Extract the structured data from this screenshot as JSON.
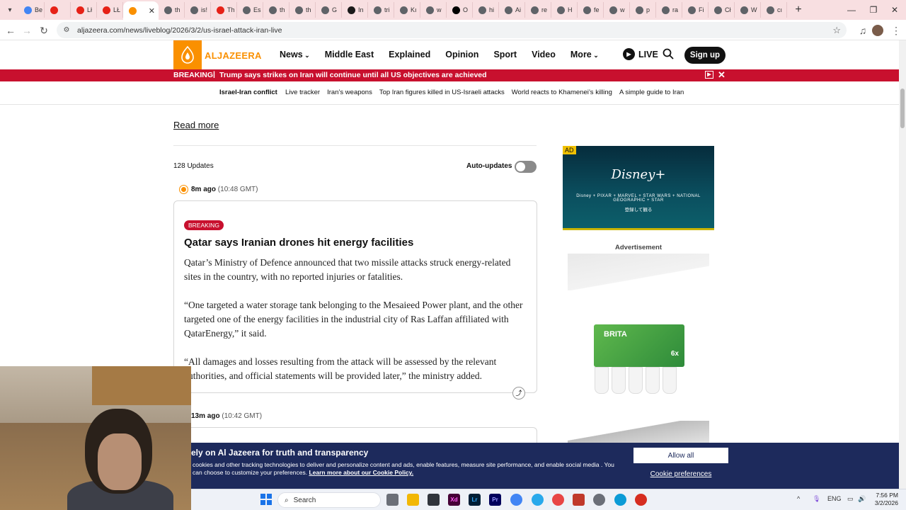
{
  "browser": {
    "tabs": [
      {
        "label": "Be",
        "color": "#4285f4"
      },
      {
        "label": "",
        "color": "#e62117"
      },
      {
        "label": "Lł",
        "color": "#e62117"
      },
      {
        "label": "LŁ",
        "color": "#e62117"
      },
      {
        "label": "",
        "color": "#fa9000",
        "active": true
      },
      {
        "label": "th",
        "color": "#5f6368"
      },
      {
        "label": "is!",
        "color": "#5f6368"
      },
      {
        "label": "Th",
        "color": "#e62117"
      },
      {
        "label": "Es",
        "color": "#5f6368"
      },
      {
        "label": "th",
        "color": "#5f6368"
      },
      {
        "label": "th",
        "color": "#5f6368"
      },
      {
        "label": "G",
        "color": "#5f6368"
      },
      {
        "label": "In",
        "color": "#1a1a1a"
      },
      {
        "label": "tri",
        "color": "#5f6368"
      },
      {
        "label": "Kı",
        "color": "#5f6368"
      },
      {
        "label": "w",
        "color": "#5f6368"
      },
      {
        "label": "O",
        "color": "#000000"
      },
      {
        "label": "hi",
        "color": "#5f6368"
      },
      {
        "label": "Ai",
        "color": "#5f6368"
      },
      {
        "label": "re",
        "color": "#5f6368"
      },
      {
        "label": "H",
        "color": "#5f6368"
      },
      {
        "label": "fe",
        "color": "#5f6368"
      },
      {
        "label": "w",
        "color": "#5f6368"
      },
      {
        "label": "p",
        "color": "#5f6368"
      },
      {
        "label": "ra",
        "color": "#5f6368"
      },
      {
        "label": "Fi",
        "color": "#5f6368"
      },
      {
        "label": "Cł",
        "color": "#5f6368"
      },
      {
        "label": "W",
        "color": "#5f6368"
      },
      {
        "label": "cı",
        "color": "#5f6368"
      }
    ],
    "url": "aljazeera.com/news/liveblog/2026/3/2/us-israel-attack-iran-live"
  },
  "site": {
    "logo": "ALJAZEERA",
    "nav": [
      "News",
      "Middle East",
      "Explained",
      "Opinion",
      "Sport",
      "Video",
      "More"
    ],
    "live": "LIVE",
    "signup": "Sign up",
    "breaking_label": "BREAKING",
    "breaking_separator": "|",
    "breaking_text": "Trump says strikes on Iran will continue until all US objectives are achieved",
    "subnav_title": "Israel-Iran conflict",
    "subnav_links": [
      "Live tracker",
      "Iran’s weapons",
      "Top Iran figures killed in US-Israeli attacks",
      "World reacts to Khamenei’s killing",
      "A simple guide to Iran"
    ]
  },
  "liveblog": {
    "read_more": "Read more",
    "updates_count": "128 Updates",
    "auto_updates_label": "Auto-updates",
    "post1": {
      "ago": "8m ago",
      "time": "(10:48 GMT)",
      "badge": "BREAKING",
      "title": "Qatar says Iranian drones hit energy facilities",
      "p1": "Qatar’s Ministry of Defence announced that two missile attacks struck energy-related sites in the country, with no reported injuries or fatalities.",
      "p2": "“One targeted a water storage tank belonging to the Mesaieed Power plant, and the other targeted one of the energy facilities in the industrial city of Ras Laffan affiliated with QatarEnergy,” it said.",
      "p3": "“All damages and losses resulting from the attack will be assessed by the relevant authorities, and official statements will be provided later,” the ministry added."
    },
    "post2": {
      "ago": "13m ago",
      "time": "(10:42 GMT)"
    }
  },
  "ads": {
    "ad_label": "AD",
    "disney": "Disney+",
    "brands": "Disney + PIXAR + MARVEL + STAR WARS + NATIONAL GEOGRAPHIC + STAR",
    "jp_text": "登録して観る",
    "advertisement_label": "Advertisement",
    "brita": "BRITA",
    "six": "6x"
  },
  "cookie": {
    "heading": "ely on Al Jazeera for truth and transparency",
    "body": "cookies and other tracking technologies to deliver and personalize content and ads, enable features, measure site performance, and enable social media . You can choose to customize your preferences.",
    "link": "Learn more about our Cookie Policy.",
    "allow": "Allow all",
    "prefs": "Cookie preferences"
  },
  "taskbar": {
    "search": "Search",
    "lang": "ENG",
    "time": "7:56 PM",
    "date": "3/2/2026"
  }
}
